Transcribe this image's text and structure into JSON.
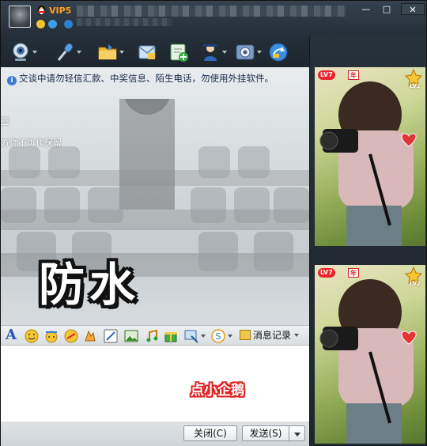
{
  "window": {
    "vip_label": "VIP5",
    "controls": {
      "minimize": "—",
      "maximize": "□",
      "close": "✕"
    }
  },
  "toolbar": {
    "buttons": [
      {
        "name": "video-call",
        "icon": "webcam-icon",
        "color": "#5b9bd5"
      },
      {
        "name": "voice-call",
        "icon": "microphone-icon",
        "color": "#3f82d0"
      },
      {
        "name": "send-file",
        "icon": "folder-icon",
        "color": "#e6a020"
      },
      {
        "name": "send-sms",
        "icon": "mail-icon",
        "color": "#7fb5e0"
      },
      {
        "name": "create-group",
        "icon": "add-group-icon",
        "color": "#3ca64a"
      },
      {
        "name": "remote-assist",
        "icon": "remote-icon",
        "color": "#4a7fc4"
      },
      {
        "name": "apps",
        "icon": "settings-icon",
        "color": "#6d8eb5"
      },
      {
        "name": "share",
        "icon": "share-icon",
        "color": "#2f7fd2"
      }
    ]
  },
  "chat": {
    "notice": "交谈中请勿轻信汇款、中奖信息、陌生电话，勿使用外挂软件。",
    "fragment_1": "签",
    "fragment_2": "方你不再作保留",
    "big_text": "防水"
  },
  "format_bar": {
    "font_label": "A",
    "icons": [
      "font-icon",
      "emoji-icon",
      "magic-emoji-icon",
      "doodle-icon",
      "shake-icon",
      "scribble-icon",
      "image-icon",
      "music-icon",
      "gift-icon",
      "screenshot-icon",
      "pay-icon"
    ],
    "history_label": "消息记录"
  },
  "input": {
    "text": "点小企鹅"
  },
  "bottom": {
    "close_label": "关闭(C)",
    "send_label": "发送(S)"
  },
  "profile": {
    "level_label": "LV7",
    "year_label": "年",
    "tier_label": "LV2"
  }
}
